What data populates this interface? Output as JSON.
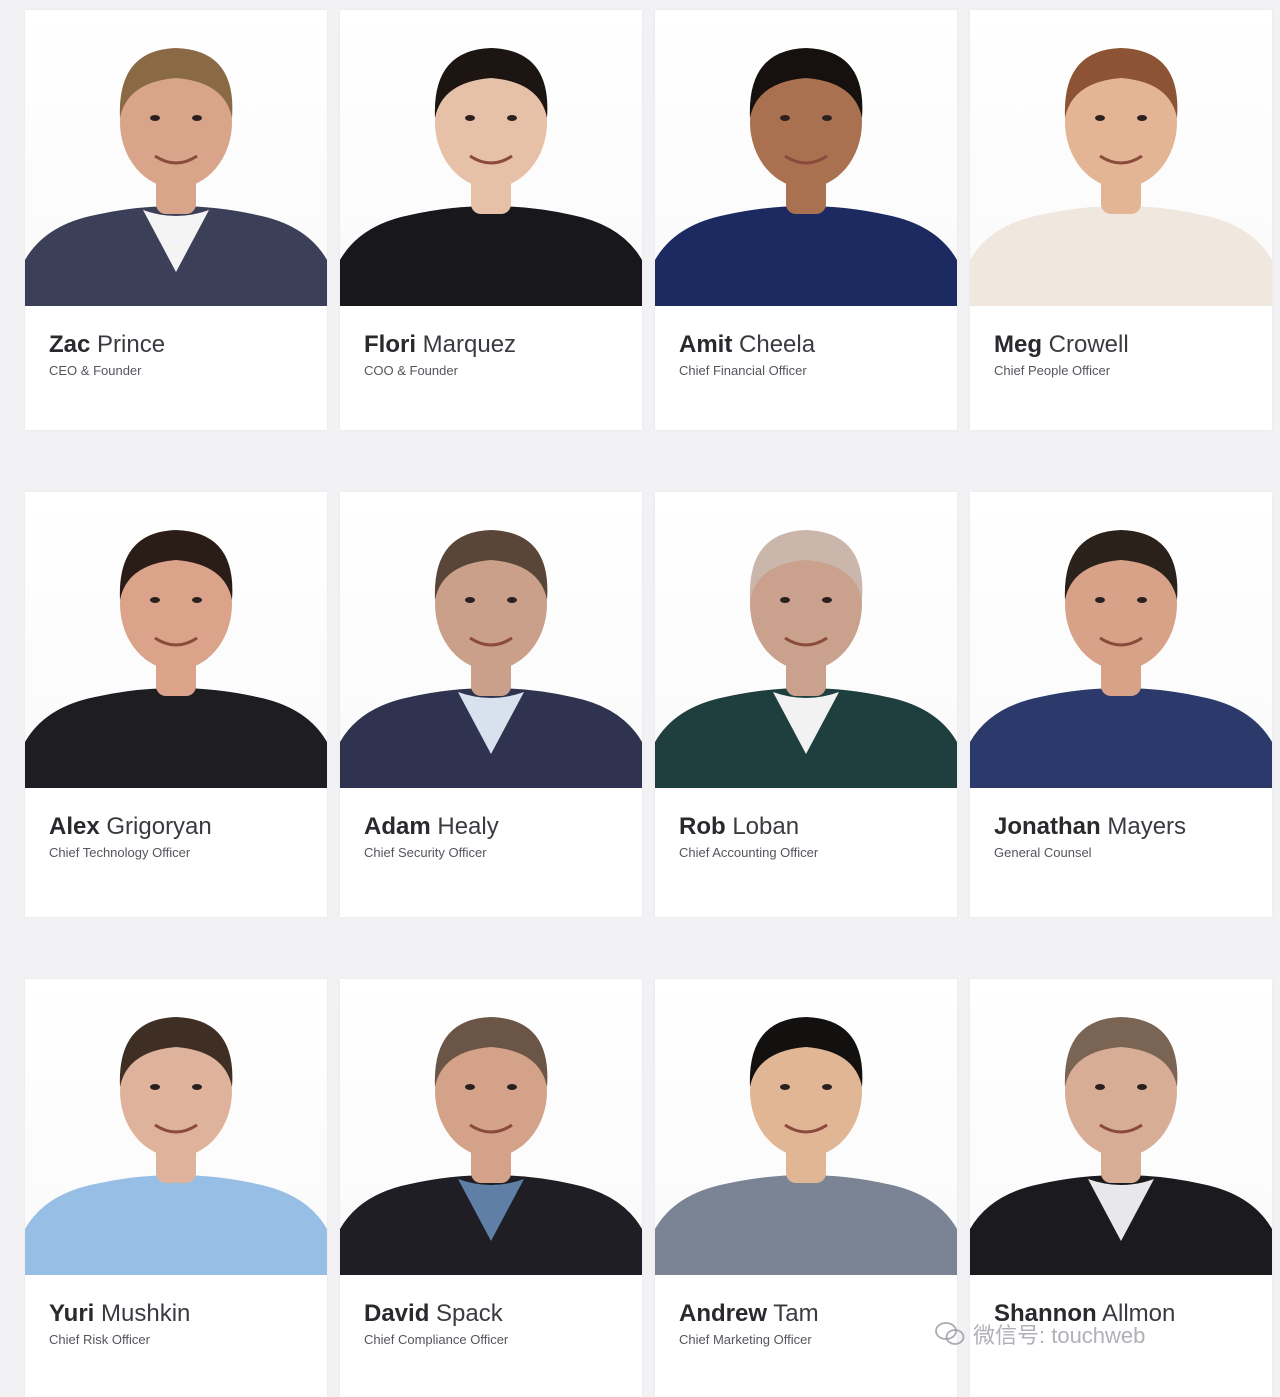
{
  "team": [
    {
      "first": "Zac",
      "last": "Prince",
      "title": "CEO & Founder",
      "suit": "#3b3f57",
      "shirt": "#f4f4f4",
      "skin": "#d9a58a",
      "hair": "#8a6a44"
    },
    {
      "first": "Flori",
      "last": "Marquez",
      "title": "COO & Founder",
      "suit": "#18181c",
      "shirt": "#18181c",
      "skin": "#e6c1a8",
      "hair": "#1c1512"
    },
    {
      "first": "Amit",
      "last": "Cheela",
      "title": "Chief Financial Officer",
      "suit": "#1d2a62",
      "shirt": "#1d2a62",
      "skin": "#a9714f",
      "hair": "#16110e"
    },
    {
      "first": "Meg",
      "last": "Crowell",
      "title": "Chief People Officer",
      "suit": "#f0e7de",
      "shirt": "#f0e7de",
      "skin": "#e4b595",
      "hair": "#8c5434"
    },
    {
      "first": "Alex",
      "last": "Grigoryan",
      "title": "Chief Technology Officer",
      "suit": "#1e1e22",
      "shirt": "#1e1e22",
      "skin": "#dba48a",
      "hair": "#2a1d17"
    },
    {
      "first": "Adam",
      "last": "Healy",
      "title": "Chief Security Officer",
      "suit": "#2f3350",
      "shirt": "#d8e2ee",
      "skin": "#caa08a",
      "hair": "#5a4638"
    },
    {
      "first": "Rob",
      "last": "Loban",
      "title": "Chief Accounting Officer",
      "suit": "#1f3f3e",
      "shirt": "#f2f2f2",
      "skin": "#c9a18c",
      "hair": "#cbb6ab"
    },
    {
      "first": "Jonathan",
      "last": "Mayers",
      "title": "General Counsel",
      "suit": "#2b3a6a",
      "shirt": "#2b3a6a",
      "skin": "#d7a287",
      "hair": "#2b211b"
    },
    {
      "first": "Yuri",
      "last": "Mushkin",
      "title": "Chief Risk Officer",
      "suit": "#97bfe6",
      "shirt": "#97bfe6",
      "skin": "#dfb29b",
      "hair": "#3e2e24"
    },
    {
      "first": "David",
      "last": "Spack",
      "title": "Chief Compliance Officer",
      "suit": "#1e1e24",
      "shirt": "#5f7fa6",
      "skin": "#d3a288",
      "hair": "#6a5546"
    },
    {
      "first": "Andrew",
      "last": "Tam",
      "title": "Chief Marketing Officer",
      "suit": "#7a8494",
      "shirt": "#7a8494",
      "skin": "#e0b694",
      "hair": "#131010"
    },
    {
      "first": "Shannon",
      "last": "Allmon",
      "title": "",
      "suit": "#1b1b1f",
      "shirt": "#e8e8ea",
      "skin": "#d8ad95",
      "hair": "#7a6454"
    }
  ],
  "watermark": {
    "text": "微信号: touchweb"
  }
}
